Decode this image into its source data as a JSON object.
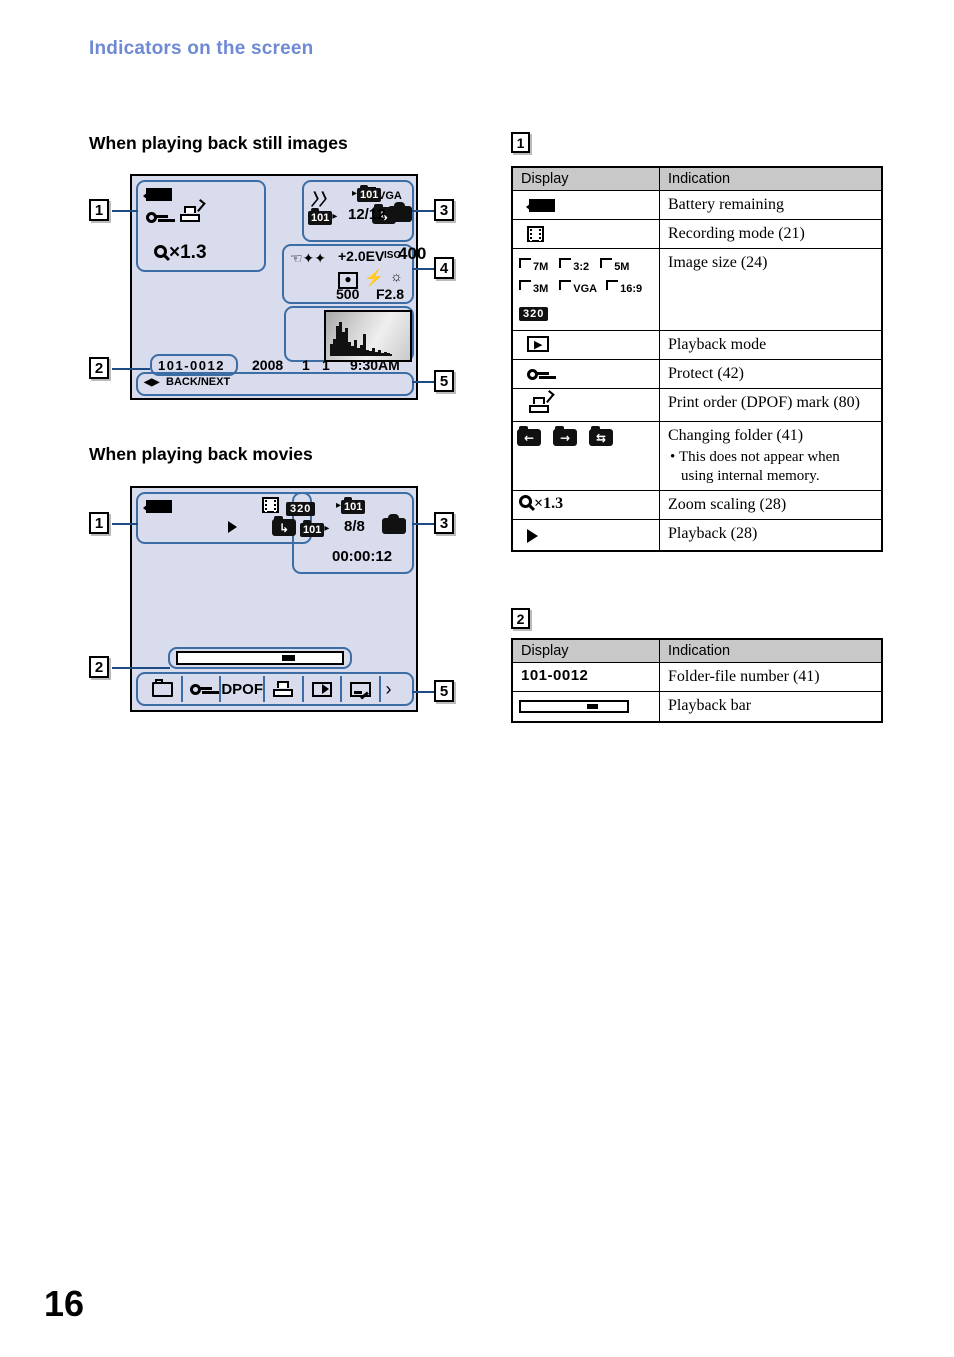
{
  "page": {
    "section_title": "Indicators on the screen",
    "folio": "16"
  },
  "headings": {
    "still": "When playing back still images",
    "movie": "When playing back movies"
  },
  "callouts": {
    "still": {
      "one": "1",
      "two": "2",
      "three": "3",
      "four": "4",
      "five": "5"
    },
    "movie": {
      "one": "1",
      "two": "2",
      "three": "3",
      "five": "5"
    }
  },
  "still_screen": {
    "image_size": "VGA",
    "zoom_scaling": "×1.3",
    "folder_next": "101",
    "folder_current": "101",
    "image_counter": "12/12",
    "ev": "+2.0EV",
    "iso_prefix": "ISO",
    "iso_value": "400",
    "shutter": "500",
    "aperture": "F2.8",
    "folder_file_number": "101-0012",
    "date_year": "2008",
    "date_month": "1",
    "date_day": "1",
    "time": "9:30AM",
    "nav_hint": "BACK/NEXT"
  },
  "movie_screen": {
    "movie_size": "320",
    "folder_next": "101",
    "folder_current": "101",
    "image_counter": "8/8",
    "elapsed_time": "00:00:12",
    "toolbar": [
      "folder-icon",
      "protect-key-icon",
      "DPOF",
      "print-icon",
      "slideshow-icon",
      "resize-icon"
    ],
    "toolbar_dpof_label": "DPOF",
    "toolbar_more": "›"
  },
  "table1": {
    "badge": "1",
    "headers": {
      "display": "Display",
      "indication": "Indication"
    },
    "rows": [
      {
        "display_kind": "battery-icon",
        "indication": "Battery remaining"
      },
      {
        "display_kind": "recording-mode-icon",
        "indication": "Recording mode (21)"
      },
      {
        "display_kind": "image-size-icons",
        "indication": "Image size (24)",
        "sizes": [
          "7M",
          "3:2",
          "5M",
          "3M",
          "VGA",
          "16:9"
        ],
        "movie_size": "320"
      },
      {
        "display_kind": "playback-mode-icon",
        "indication": "Playback mode"
      },
      {
        "display_kind": "protect-key-icon",
        "indication": "Protect (42)"
      },
      {
        "display_kind": "print-order-icon",
        "indication": "Print order (DPOF) mark (80)"
      },
      {
        "display_kind": "changing-folder-icons",
        "indication": "Changing folder (41)",
        "note": "This does not appear when using internal memory."
      },
      {
        "display_kind": "zoom-scaling-text",
        "display_text": "×1.3",
        "indication": "Zoom scaling (28)"
      },
      {
        "display_kind": "playback-triangle",
        "indication": "Playback (28)"
      }
    ]
  },
  "table2": {
    "badge": "2",
    "headers": {
      "display": "Display",
      "indication": "Indication"
    },
    "rows": [
      {
        "display_kind": "text",
        "display_text": "101-0012",
        "indication": "Folder-file number (41)"
      },
      {
        "display_kind": "playback-bar",
        "indication": "Playback bar"
      }
    ]
  }
}
